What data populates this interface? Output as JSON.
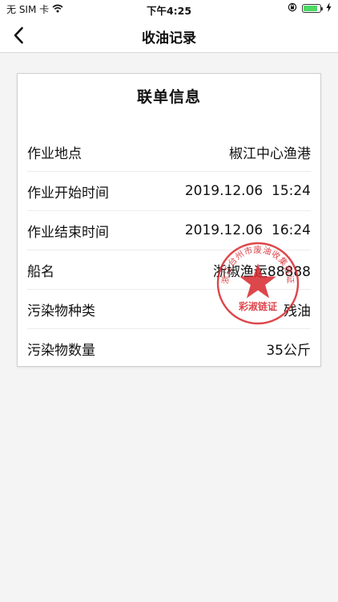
{
  "status_bar": {
    "carrier": "无 SIM 卡",
    "time": "下午4:25",
    "battery_level": 0.85
  },
  "nav": {
    "title": "收油记录"
  },
  "card": {
    "title": "联单信息",
    "rows": [
      {
        "label": "作业地点",
        "value": "椒江中心渔港"
      },
      {
        "label": "作业开始时间",
        "value": "2019.12.06  15:24"
      },
      {
        "label": "作业结束时间",
        "value": "2019.12.06  16:24"
      },
      {
        "label": "船名",
        "value": "浙椒渔运88888"
      },
      {
        "label": "污染物种类",
        "value": "残油"
      },
      {
        "label": "污染物数量",
        "value": "35公斤"
      }
    ]
  },
  "seal": {
    "arc_text": "浙江台州市废油收集链证",
    "center_text": "彩淑链证",
    "color": "#d8262c"
  }
}
